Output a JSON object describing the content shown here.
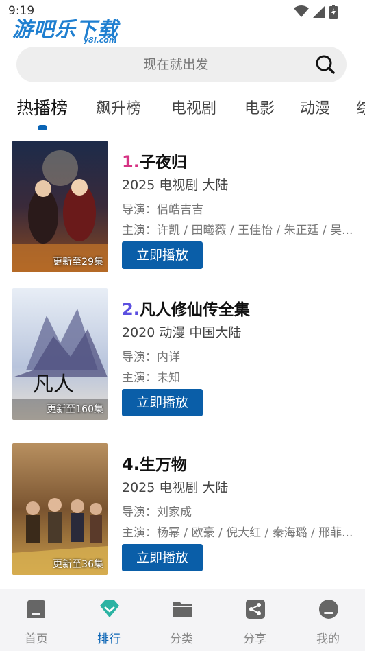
{
  "status": {
    "time": "9:19"
  },
  "logo": {
    "main": "游吧乐下载",
    "sub": "y8l.com"
  },
  "search": {
    "placeholder": "现在就出发"
  },
  "tabs": [
    {
      "label": "热播榜",
      "active": true
    },
    {
      "label": "飙升榜",
      "active": false
    },
    {
      "label": "电视剧",
      "active": false
    },
    {
      "label": "电影",
      "active": false
    },
    {
      "label": "动漫",
      "active": false
    },
    {
      "label": "综",
      "active": false
    }
  ],
  "items": [
    {
      "rank": "1.",
      "rank_color": "#d63384",
      "title": "子夜归",
      "meta": "2025 电视剧 大陆",
      "director": "导演：侣皓吉吉",
      "cast": "主演：许凯 / 田曦薇 / 王佳怡 / 朱正廷 / 吴...",
      "update": "更新至29集",
      "play_label": "立即播放"
    },
    {
      "rank": "2.",
      "rank_color": "#5b4fe0",
      "title": "凡人修仙传全集",
      "meta": "2020 动漫 中国大陆",
      "director": "导演：内详",
      "cast": "主演：未知",
      "update": "更新至160集",
      "play_label": "立即播放"
    },
    {
      "rank": "4.",
      "rank_color": "#111111",
      "title": "生万物",
      "meta": "2025 电视剧 大陆",
      "director": "导演：刘家成",
      "cast": "主演：杨幂 / 欧豪 / 倪大红 / 秦海璐 / 邢菲...",
      "update": "更新至36集",
      "play_label": "立即播放"
    }
  ],
  "bottom_nav": [
    {
      "label": "首页",
      "icon": "home-icon",
      "active": false
    },
    {
      "label": "排行",
      "icon": "ranking-diamond-icon",
      "active": true
    },
    {
      "label": "分类",
      "icon": "folder-icon",
      "active": false
    },
    {
      "label": "分享",
      "icon": "share-icon",
      "active": false
    },
    {
      "label": "我的",
      "icon": "profile-icon",
      "active": false
    }
  ],
  "colors": {
    "accent": "#0a64b5",
    "button": "#0a5ea8",
    "active_nav": "#2bb3a3"
  }
}
